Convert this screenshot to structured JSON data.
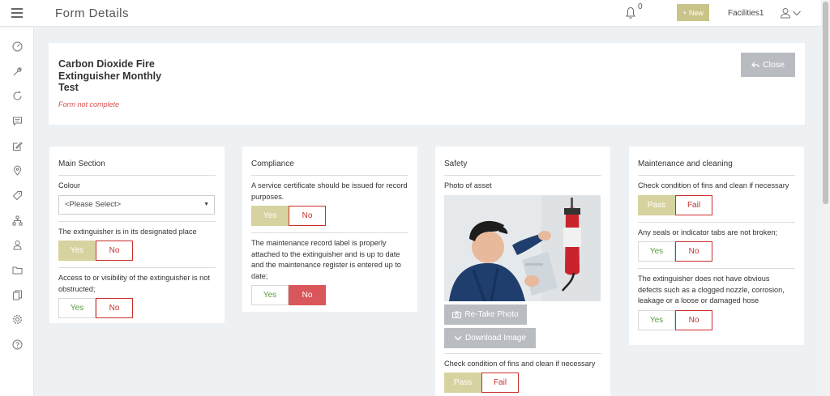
{
  "topbar": {
    "page_title": "Form Details",
    "notification_count": "0",
    "new_label": "+ New",
    "user_name": "Facilities1"
  },
  "header": {
    "form_name": "Carbon Dioxide Fire Extinguisher Monthly Test",
    "status": "Form not complete",
    "close_label": "Close"
  },
  "sections": {
    "main": {
      "title": "Main Section",
      "colour_label": "Colour",
      "colour_value": "<Please Select>",
      "q1": "The extinguisher is in its designated place",
      "q2": "Access to or visibility of the extinguisher is not obstructed;",
      "yes": "Yes",
      "no": "No"
    },
    "compliance": {
      "title": "Compliance",
      "q1": "A service certificate should be issued for record purposes.",
      "q2": "The maintenance record label is properly attached to the extinguisher and is up to date and the maintenance register is entered up to date;",
      "yes": "Yes",
      "no": "No"
    },
    "safety": {
      "title": "Safety",
      "photo_label": "Photo of asset",
      "retake_label": "Re-Take Photo",
      "download_label": "Download Image",
      "q1": "Check condition of fins and clean if necessary",
      "pass": "Pass",
      "fail": "Fail"
    },
    "maintenance": {
      "title": "Maintenance and cleaning",
      "q1": "Check condition of fins and clean if necessary",
      "q2": "Any seals or indicator tabs are not broken;",
      "q3": "The extinguisher does not have obvious defects such as a clogged nozzle, corrosion, leakage or a loose or damaged hose",
      "pass": "Pass",
      "fail": "Fail",
      "yes": "Yes",
      "no": "No"
    }
  },
  "colors": {
    "accent": "#c9c487",
    "selected_yes": "#d6d3a0",
    "selected_no": "#d9575a",
    "no_text": "#c9302c",
    "yes_text": "#5a9a3f",
    "status_red": "#d9534f"
  }
}
